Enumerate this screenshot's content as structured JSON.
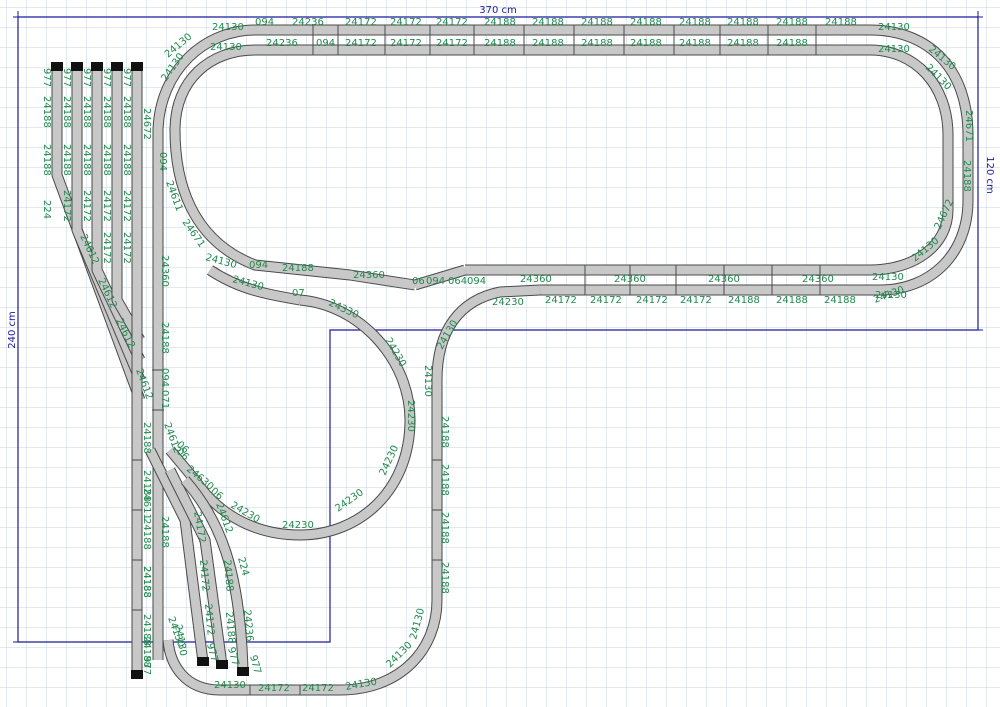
{
  "dimensions": {
    "width_label": "370 cm",
    "height_label": "120 cm",
    "side_label": "240 cm"
  },
  "colors": {
    "grid": "#c9d3e0",
    "outline": "#1a1a9a",
    "label": "#1f8a4c",
    "rail": "#4a4a4a",
    "bed": "#c8c8c8",
    "bumper": "#111111"
  },
  "labels": {
    "outer_top": [
      "24130",
      "094",
      "24236",
      "24172",
      "24172",
      "24172",
      "24188",
      "24188",
      "24188",
      "24188",
      "24188",
      "24188",
      "24188",
      "24188",
      "24130"
    ],
    "inner_top": [
      "24130",
      "24236",
      "094",
      "24172",
      "24172",
      "24172",
      "24188",
      "24188",
      "24188",
      "24188",
      "24188",
      "24188",
      "24188",
      "24130"
    ],
    "right_curve": [
      "24130",
      "24130",
      "24671",
      "24188",
      "24672",
      "24130",
      "24130"
    ],
    "middle_line": [
      "24130",
      "094",
      "24188",
      "24360",
      "06",
      "094",
      "064",
      "094",
      "24360",
      "24360",
      "24360",
      "24360",
      "24130"
    ],
    "lower_line": [
      "24230",
      "24172",
      "24172",
      "24172",
      "24172",
      "24188",
      "24188",
      "24188",
      "24130"
    ],
    "left_upper": [
      "24130",
      "24130",
      "24672",
      "094",
      "24611",
      "24671",
      "24360"
    ],
    "yard_ends": [
      "977",
      "977",
      "977",
      "977",
      "977"
    ],
    "yard_cols": [
      "24188",
      "24188",
      "24188",
      "24188",
      "24188",
      "24188",
      "24188",
      "24188",
      "24188",
      "24188",
      "24172",
      "24172",
      "24172",
      "24172",
      "24172",
      "24172"
    ],
    "yard_ladder": [
      "224",
      "24612",
      "24612",
      "24612",
      "24612"
    ],
    "left_line": [
      "24130",
      "07",
      "24330",
      "24188",
      "094",
      "071",
      "24188",
      "24188",
      "24188",
      "24188",
      "24188",
      "24188"
    ],
    "loop": [
      "24230",
      "24230",
      "24230",
      "24230",
      "24230",
      "24230"
    ],
    "right_descent": [
      "24130",
      "24130",
      "24188",
      "24188",
      "24188",
      "24188",
      "24130",
      "24130"
    ],
    "bottom": [
      "24130",
      "24172",
      "24172",
      "24130",
      "24130"
    ],
    "sidings": [
      "06",
      "24630",
      "06",
      "24612",
      "24172",
      "24172",
      "24172",
      "24188",
      "24188",
      "24236",
      "224",
      "977",
      "977",
      "977",
      "24130",
      "24188"
    ],
    "misc": [
      "24611",
      "06",
      "24612",
      "24188",
      "977"
    ]
  }
}
